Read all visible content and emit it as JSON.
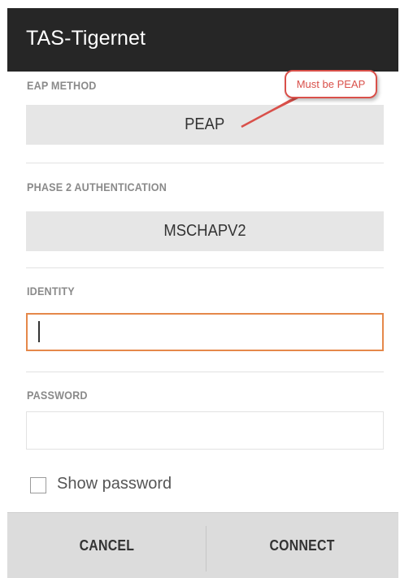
{
  "dialog": {
    "title": "TAS-Tigernet"
  },
  "eap_method": {
    "label": "EAP METHOD",
    "value": "PEAP",
    "callout": "Must be PEAP"
  },
  "phase2": {
    "label": "PHASE 2 AUTHENTICATION",
    "value": "MSCHAPV2"
  },
  "identity": {
    "label": "IDENTITY",
    "value": ""
  },
  "password": {
    "label": "PASSWORD",
    "value": ""
  },
  "show_password": {
    "label": "Show password",
    "checked": false
  },
  "buttons": {
    "cancel": "CANCEL",
    "connect": "CONNECT"
  },
  "colors": {
    "title_bar": "#262626",
    "focus_border": "#e5884a",
    "callout": "#d9504a"
  }
}
